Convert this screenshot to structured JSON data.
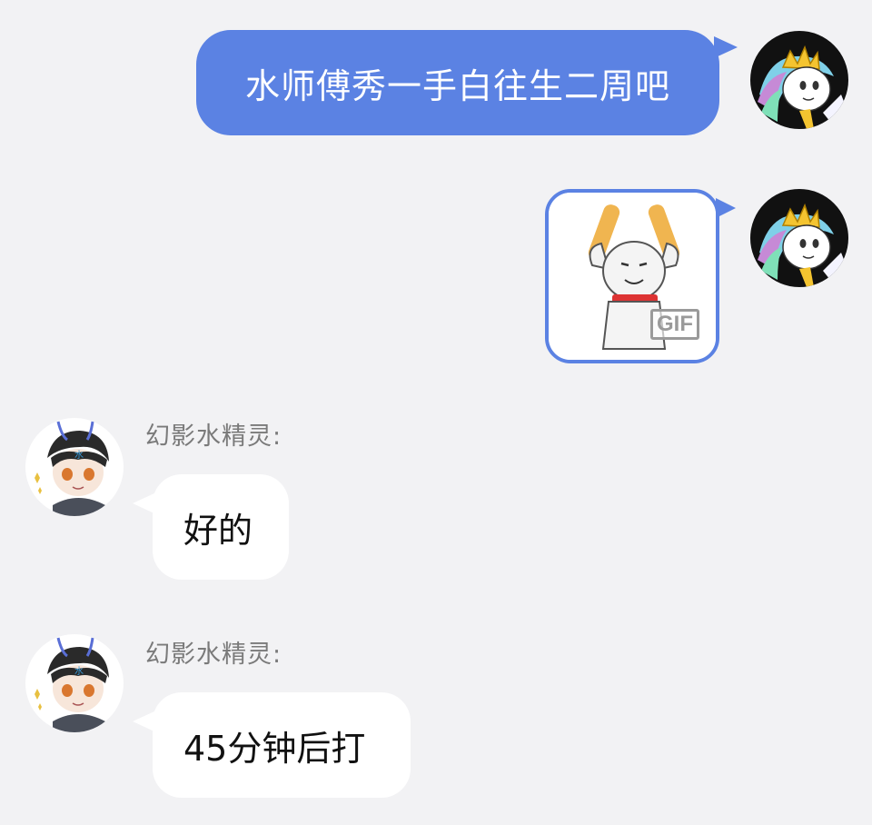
{
  "messages": {
    "outgoing_text": "水师傅秀一手白往生二周吧",
    "gif_badge": "GIF",
    "incoming": [
      {
        "sender": "幻影水精灵:",
        "text": "好的"
      },
      {
        "sender": "幻影水精灵:",
        "text": "45分钟后打"
      }
    ]
  },
  "icons": {
    "self_avatar": "pony-princess-avatar",
    "other_avatar": "anime-boy-avatar",
    "sticker": "meme-cat-glowsticks-sticker"
  },
  "colors": {
    "background": "#f2f2f4",
    "outgoing_bubble": "#5b82e3",
    "incoming_bubble": "#ffffff",
    "sender_name": "#7a7a7a"
  }
}
